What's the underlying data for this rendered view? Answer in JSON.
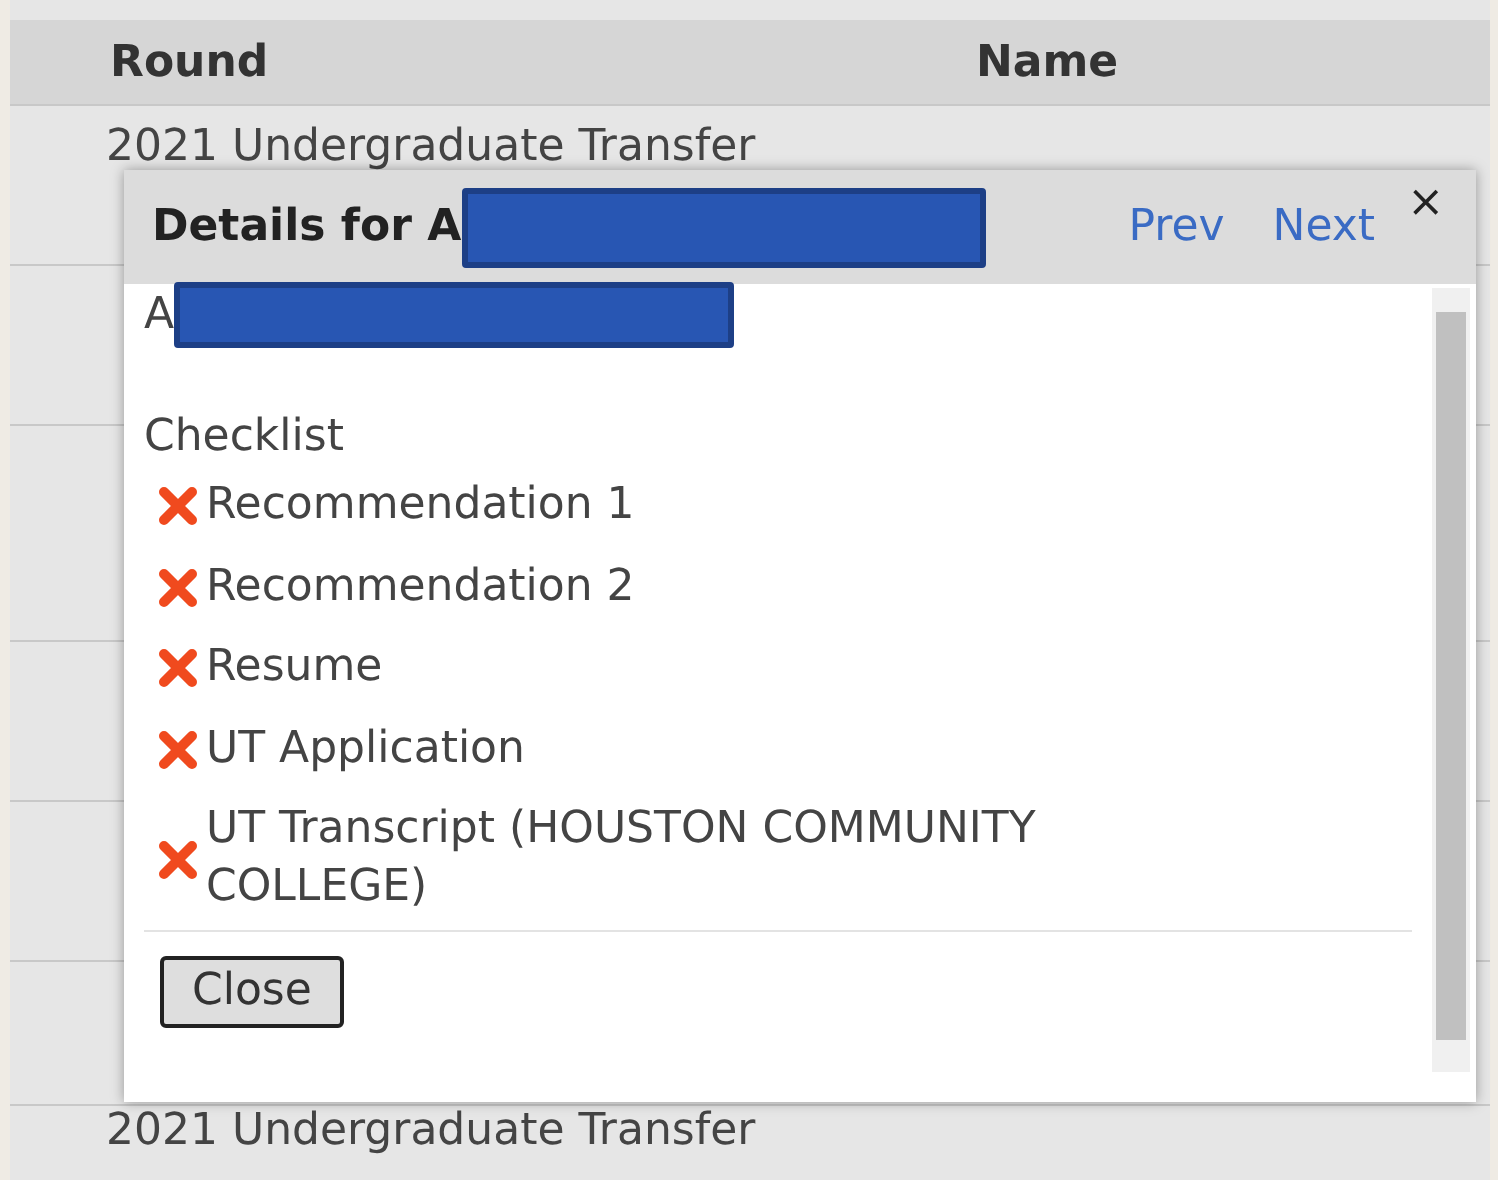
{
  "table": {
    "columns": [
      "Round",
      "Name"
    ],
    "rows": [
      {
        "round": "2021 Undergraduate Transfer"
      },
      {
        "round": "2021 Undergraduate Transfer"
      }
    ]
  },
  "dialog": {
    "title": "Details for A",
    "prev": "Prev",
    "next": "Next",
    "close_icon": "×",
    "subtitle": "A",
    "section": "Checklist",
    "checklist": [
      {
        "label": "Recommendation 1",
        "complete": false
      },
      {
        "label": "Recommendation 2",
        "complete": false
      },
      {
        "label": "Resume",
        "complete": false
      },
      {
        "label": "UT Application",
        "complete": false
      },
      {
        "label": "UT Transcript (HOUSTON COMMUNITY COLLEGE)",
        "complete": false
      }
    ],
    "button": "Close"
  }
}
